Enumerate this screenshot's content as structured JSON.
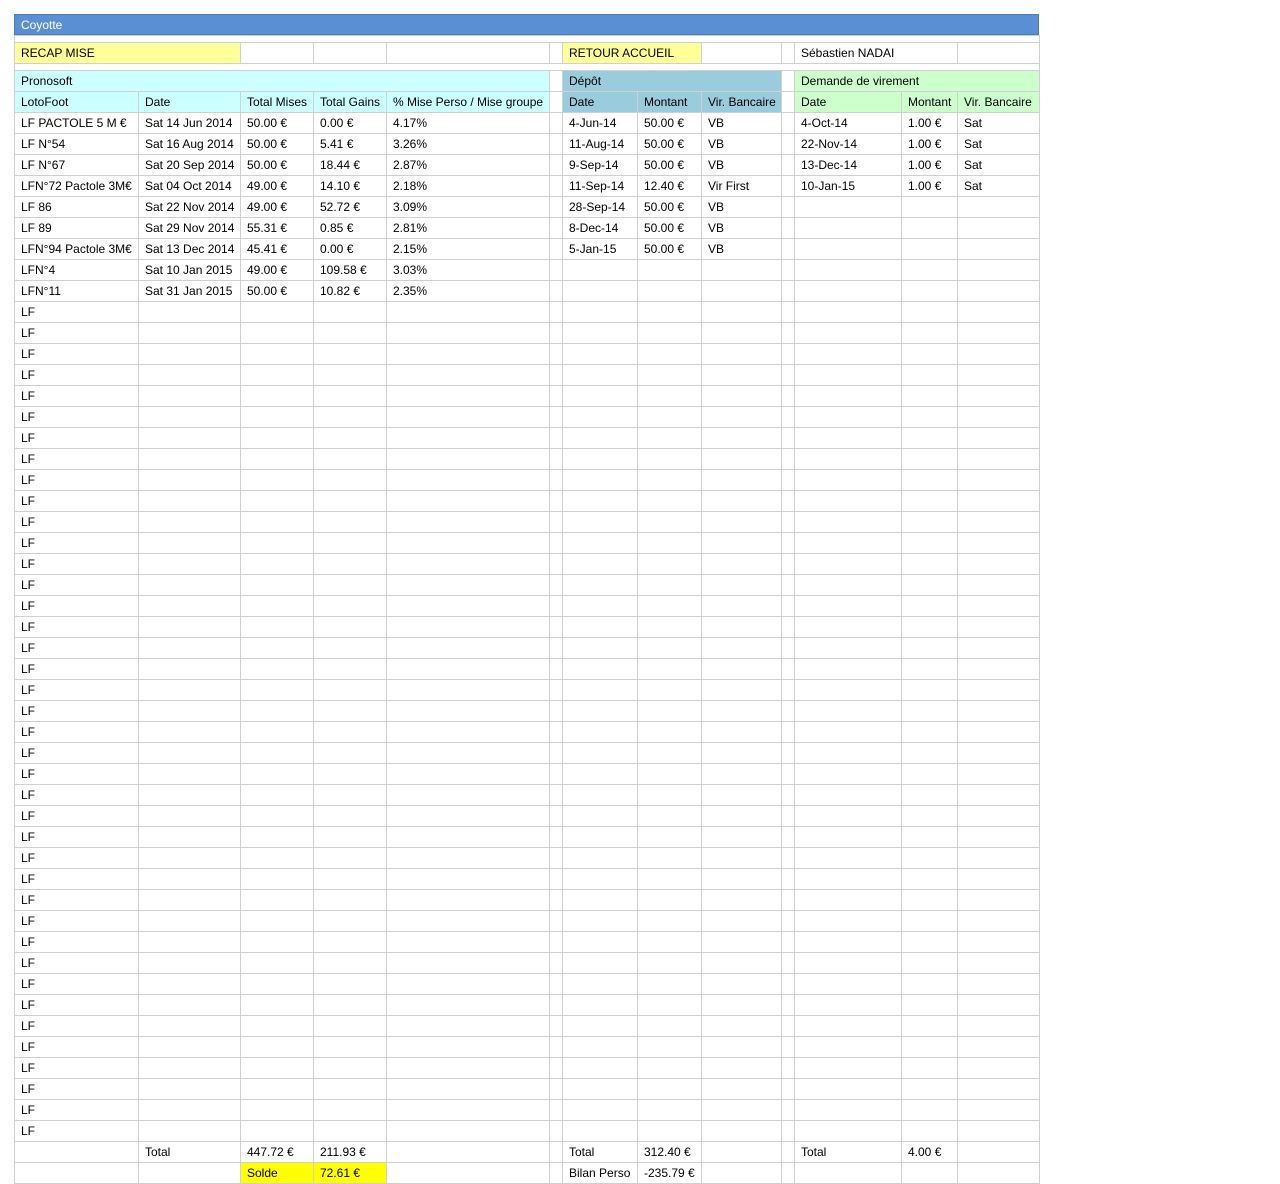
{
  "title": "Coyotte",
  "top": {
    "recap_mise": "RECAP MISE",
    "retour_accueil": "RETOUR ACCUEIL",
    "user_name": "Sébastien NADAI"
  },
  "sections": {
    "pronosoft": "Pronosoft",
    "depot": "Dépôt",
    "virement": "Demande de virement"
  },
  "headers": {
    "lf": [
      "LotoFoot",
      "Date",
      "Total Mises",
      "Total Gains",
      "% Mise Perso / Mise groupe"
    ],
    "depot": [
      "Date",
      "Montant",
      "Vir. Bancaire"
    ],
    "virement": [
      "Date",
      "Montant",
      "Vir. Bancaire"
    ]
  },
  "lf_rows": [
    [
      "LF PACTOLE 5 M €",
      "Sat 14 Jun 2014",
      "50.00 €",
      "0.00 €",
      "4.17%"
    ],
    [
      "LF N°54",
      "Sat 16 Aug 2014",
      "50.00 €",
      "5.41 €",
      "3.26%"
    ],
    [
      "LF N°67",
      "Sat 20 Sep 2014",
      "50.00 €",
      "18.44 €",
      "2.87%"
    ],
    [
      "LFN°72 Pactole 3M€",
      "Sat 04 Oct 2014",
      "49.00 €",
      "14.10 €",
      "2.18%"
    ],
    [
      "LF 86",
      "Sat 22 Nov 2014",
      "49.00 €",
      "52.72 €",
      "3.09%"
    ],
    [
      "LF 89",
      "Sat 29 Nov 2014",
      "55.31 €",
      "0.85 €",
      "2.81%"
    ],
    [
      "LFN°94 Pactole 3M€",
      "Sat 13 Dec 2014",
      "45.41 €",
      "0.00 €",
      "2.15%"
    ],
    [
      "LFN°4",
      "Sat 10 Jan 2015",
      "49.00 €",
      "109.58 €",
      "3.03%"
    ],
    [
      "LFN°11",
      "Sat 31 Jan 2015",
      "50.00 €",
      "10.82 €",
      "2.35%"
    ],
    [
      "LF"
    ],
    [
      "LF"
    ],
    [
      "LF"
    ],
    [
      "LF"
    ],
    [
      "LF"
    ],
    [
      "LF"
    ],
    [
      "LF"
    ],
    [
      "LF"
    ],
    [
      "LF"
    ],
    [
      "LF"
    ],
    [
      "LF"
    ],
    [
      "LF"
    ],
    [
      "LF"
    ],
    [
      "LF"
    ],
    [
      "LF"
    ],
    [
      "LF"
    ],
    [
      "LF"
    ],
    [
      "LF"
    ],
    [
      "LF"
    ],
    [
      "LF"
    ],
    [
      "LF"
    ],
    [
      "LF"
    ],
    [
      "LF"
    ],
    [
      "LF"
    ],
    [
      "LF"
    ],
    [
      "LF"
    ],
    [
      "LF"
    ],
    [
      "LF"
    ],
    [
      "LF"
    ],
    [
      "LF"
    ],
    [
      "LF"
    ],
    [
      "LF"
    ],
    [
      "LF"
    ],
    [
      "LF"
    ],
    [
      "LF"
    ],
    [
      "LF"
    ],
    [
      "LF"
    ],
    [
      "LF"
    ],
    [
      "LF"
    ],
    [
      "LF"
    ]
  ],
  "depot_rows": [
    [
      "4-Jun-14",
      "50.00 €",
      "VB"
    ],
    [
      "11-Aug-14",
      "50.00 €",
      "VB"
    ],
    [
      "9-Sep-14",
      "50.00 €",
      "VB"
    ],
    [
      "11-Sep-14",
      "12.40 €",
      "Vir First"
    ],
    [
      "28-Sep-14",
      "50.00 €",
      "VB"
    ],
    [
      "8-Dec-14",
      "50.00 €",
      "VB"
    ],
    [
      "5-Jan-15",
      "50.00 €",
      "VB"
    ]
  ],
  "virement_rows": [
    [
      "4-Oct-14",
      "1.00 €",
      "Sat"
    ],
    [
      "22-Nov-14",
      "1.00 €",
      "Sat"
    ],
    [
      "13-Dec-14",
      "1.00 €",
      "Sat"
    ],
    [
      "10-Jan-15",
      "1.00 €",
      "Sat"
    ]
  ],
  "totals": {
    "label": "Total",
    "lf_mises": "447.72 €",
    "lf_gains": "211.93 €",
    "depot_total": "312.40 €",
    "virement_total": "4.00 €",
    "solde_label": "Solde",
    "solde_value": "72.61 €",
    "bilan_label": "Bilan Perso",
    "bilan_value": "-235.79 €"
  },
  "colors": {
    "title_bar": "#5b8fd4",
    "yellow": "#ffff99",
    "cyan": "#ccffff",
    "blue": "#99ccdd",
    "green": "#ccffcc",
    "solde": "#ffff00"
  }
}
